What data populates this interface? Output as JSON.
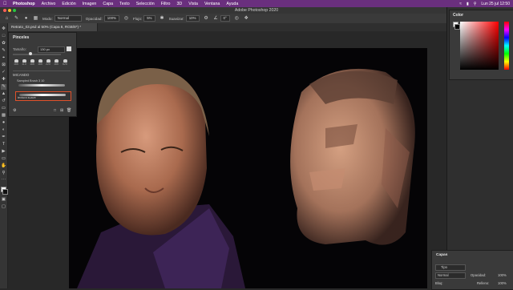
{
  "menubar": {
    "app": "Photoshop",
    "items": [
      "Archivo",
      "Edición",
      "Imagen",
      "Capa",
      "Texto",
      "Selección",
      "Filtro",
      "3D",
      "Vista",
      "Ventana",
      "Ayuda"
    ],
    "clock": "Lun 25 jul 12:50"
  },
  "window": {
    "title": "Adobe Photoshop 2020"
  },
  "options": {
    "mode_label": "Modo:",
    "mode_value": "Normal",
    "opacity_label": "Opacidad:",
    "opacity_value": "100%",
    "flow_label": "Flujo:",
    "flow_value": "5%",
    "smoothing_label": "Suavizar:",
    "smoothing_value": "10%",
    "angle_value": "0°"
  },
  "document": {
    "tab_title": "Retrato_03.psd al 50% (Capa 8, RGB/8*) *"
  },
  "brushes_panel": {
    "title": "Pinceles",
    "size_label": "Tamaño:",
    "size_value": "130 px",
    "presets": [
      "165",
      "110",
      "165",
      "165",
      "220",
      "165",
      "625"
    ],
    "group_name": "MICANDO",
    "strokes": [
      {
        "name": "Sampled Brush 3 10"
      },
      {
        "name": "textura suave"
      }
    ]
  },
  "color_panel": {
    "title": "Color"
  },
  "layers_panel": {
    "title": "Capas",
    "filter_label": "Tipo",
    "blend_mode": "Normal",
    "opacity_label": "Opacidad:",
    "opacity_value": "100%",
    "lock_label": "Bloq:",
    "fill_label": "Relleno:",
    "fill_value": "100%"
  },
  "colors": {
    "menubar": "#6a2f7e",
    "accent_selection": "#e0512b"
  }
}
